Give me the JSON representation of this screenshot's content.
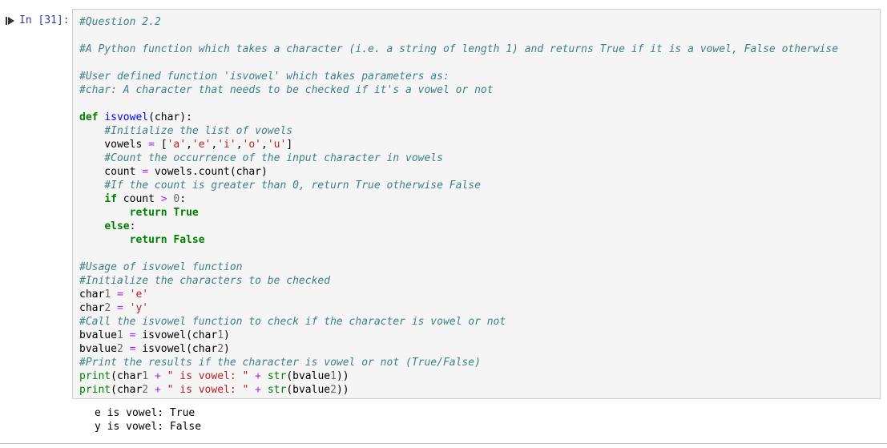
{
  "cell": {
    "prompt": "In [31]:",
    "code_lines": [
      "#Question 2.2",
      "",
      "#A Python function which takes a character (i.e. a string of length 1) and returns True if it is a vowel, False otherwise",
      "",
      "#User defined function 'isvowel' which takes parameters as:",
      "#char: A character that needs to be checked if it's a vowel or not",
      "",
      "def isvowel(char):",
      "    #Initialize the list of vowels",
      "    vowels = ['a','e','i','o','u']",
      "    #Count the occurrence of the input character in vowels",
      "    count = vowels.count(char)",
      "    #If the count is greater than 0, return True otherwise False",
      "    if count > 0:",
      "        return True",
      "    else:",
      "        return False",
      "",
      "#Usage of isvowel function",
      "#Initialize the characters to be checked",
      "char1 = 'e'",
      "char2 = 'y'",
      "#Call the isvowel function to check if the character is vowel or not",
      "bvalue1 = isvowel(char1)",
      "bvalue2 = isvowel(char2)",
      "#Print the results if the character is vowel or not (True/False)",
      "print(char1 + \" is vowel: \" + str(bvalue1))",
      "print(char2 + \" is vowel: \" + str(bvalue2))"
    ],
    "output_lines": [
      "e is vowel: True",
      "y is vowel: False"
    ]
  },
  "icons": {
    "run": "run-cell-icon"
  },
  "colors": {
    "prompt": "#303f9f",
    "comment": "#408080",
    "keyword": "#008000",
    "function_name": "#0000ff",
    "string": "#ba2121",
    "operator": "#aa22ff",
    "cell_background": "#f5f5f5",
    "cell_border": "#cfcfcf"
  }
}
